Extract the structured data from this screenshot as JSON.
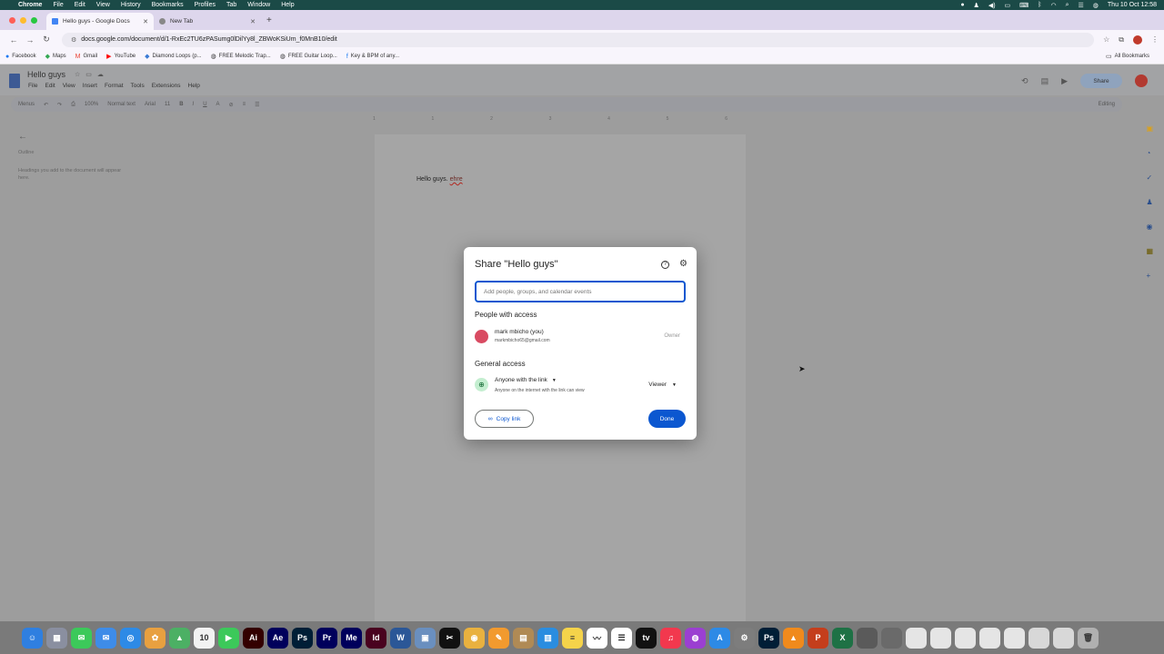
{
  "menubar": {
    "items": [
      "Chrome",
      "File",
      "Edit",
      "View",
      "History",
      "Bookmarks",
      "Profiles",
      "Tab",
      "Window",
      "Help"
    ],
    "datetime": "Thu 10 Oct  12:58"
  },
  "browser": {
    "tabs": [
      {
        "label": "Hello guys - Google Docs",
        "active": true
      },
      {
        "label": "New Tab",
        "active": false
      }
    ],
    "url": "docs.google.com/document/d/1-RxEc2TU6zPASumg0lDilYy8l_ZBWoKSiUm_f0MnB10/edit",
    "bookmarks": [
      "Facebook",
      "Maps",
      "Gmail",
      "YouTube",
      "Diamond Loops (p...",
      "FREE Melodic Trap...",
      "FREE Guitar Loop...",
      "Key & BPM of any..."
    ],
    "all_bookmarks": "All Bookmarks"
  },
  "doc": {
    "title": "Hello guys",
    "menus": [
      "File",
      "Edit",
      "View",
      "Insert",
      "Format",
      "Tools",
      "Extensions",
      "Help"
    ],
    "share_label": "Share",
    "toolbar": {
      "menus": "Menus",
      "zoom": "100%",
      "style": "Normal text",
      "font": "Arial",
      "size": "11",
      "mode": "Editing"
    },
    "ruler": [
      "1",
      "1",
      "2",
      "3",
      "4",
      "5",
      "6"
    ],
    "outline_title": "Outline",
    "outline_note": "Headings you add to the document will appear here.",
    "body_text": "Hello guys. ",
    "body_misspelled": "ehre"
  },
  "dialog": {
    "title": "Share \"Hello guys\"",
    "input_placeholder": "Add people, groups, and calendar events",
    "people_heading": "People with access",
    "person": {
      "name": "mark mbicho (you)",
      "email": "markmbicho65@gmail.com",
      "role": "Owner"
    },
    "general_heading": "General access",
    "access": {
      "scope": "Anyone with the link",
      "description": "Anyone on the internet with the link can view",
      "role": "Viewer"
    },
    "copy_link": "Copy link",
    "done": "Done"
  },
  "dock": {
    "apps": [
      {
        "name": "Finder",
        "glyph": "☺",
        "color": "#2f7fe0"
      },
      {
        "name": "Launchpad",
        "glyph": "▦",
        "color": "#8a8fa0"
      },
      {
        "name": "Messages",
        "glyph": "✉",
        "color": "#3cc95a"
      },
      {
        "name": "Mail",
        "glyph": "✉",
        "color": "#3e8ce8"
      },
      {
        "name": "Safari",
        "glyph": "◎",
        "color": "#2d8ae6"
      },
      {
        "name": "Photos",
        "glyph": "✿",
        "color": "#e8a040"
      },
      {
        "name": "Maps",
        "glyph": "▲",
        "color": "#4cb064"
      },
      {
        "name": "Calendar",
        "glyph": "10",
        "color": "#f2f2f2"
      },
      {
        "name": "FaceTime",
        "glyph": "▶",
        "color": "#3cc95a"
      },
      {
        "name": "Illustrator",
        "glyph": "Ai",
        "color": "#330000"
      },
      {
        "name": "After Effects",
        "glyph": "Ae",
        "color": "#00005b"
      },
      {
        "name": "Photoshop",
        "glyph": "Ps",
        "color": "#001e36"
      },
      {
        "name": "Premiere",
        "glyph": "Pr",
        "color": "#00005b"
      },
      {
        "name": "Media Encoder",
        "glyph": "Me",
        "color": "#00005b"
      },
      {
        "name": "InDesign",
        "glyph": "Id",
        "color": "#49021f"
      },
      {
        "name": "Word",
        "glyph": "W",
        "color": "#2b5797"
      },
      {
        "name": "Preview",
        "glyph": "▣",
        "color": "#6a8fbf"
      },
      {
        "name": "CapCut",
        "glyph": "✂",
        "color": "#111111"
      },
      {
        "name": "Chrome",
        "glyph": "◉",
        "color": "#e9b13f"
      },
      {
        "name": "Pages",
        "glyph": "✎",
        "color": "#f29a2e"
      },
      {
        "name": "Archive",
        "glyph": "▤",
        "color": "#b08a55"
      },
      {
        "name": "Keynote",
        "glyph": "▥",
        "color": "#2a8de0"
      },
      {
        "name": "Notes",
        "glyph": "≡",
        "color": "#f5d34a"
      },
      {
        "name": "Freeform",
        "glyph": "〰",
        "color": "#ffffff"
      },
      {
        "name": "Reminders",
        "glyph": "☰",
        "color": "#ffffff"
      },
      {
        "name": "Apple TV",
        "glyph": "tv",
        "color": "#111111"
      },
      {
        "name": "Music",
        "glyph": "♫",
        "color": "#f2384e"
      },
      {
        "name": "Podcasts",
        "glyph": "◍",
        "color": "#9b3fd1"
      },
      {
        "name": "App Store",
        "glyph": "A",
        "color": "#2d8ae6"
      },
      {
        "name": "System Settings",
        "glyph": "⚙",
        "color": "#7d7d7d"
      },
      {
        "name": "Photoshop",
        "glyph": "Ps",
        "color": "#001e36"
      },
      {
        "name": "VLC",
        "glyph": "▲",
        "color": "#f08a1c"
      },
      {
        "name": "PowerPoint",
        "glyph": "P",
        "color": "#c43e1c"
      },
      {
        "name": "Excel",
        "glyph": "X",
        "color": "#1e7145"
      },
      {
        "name": "Window 1",
        "glyph": "",
        "color": "#5a5a5a"
      },
      {
        "name": "Window 2",
        "glyph": "",
        "color": "#6a6a6a"
      },
      {
        "name": "Window 3",
        "glyph": "",
        "color": "#e5e5e5"
      },
      {
        "name": "Window 4",
        "glyph": "",
        "color": "#e5e5e5"
      },
      {
        "name": "Window 5",
        "glyph": "",
        "color": "#e5e5e5"
      },
      {
        "name": "Window 6",
        "glyph": "",
        "color": "#e5e5e5"
      },
      {
        "name": "Window 7",
        "glyph": "",
        "color": "#e5e5e5"
      },
      {
        "name": "Window 8",
        "glyph": "",
        "color": "#d8d8d8"
      },
      {
        "name": "Window 9",
        "glyph": "",
        "color": "#d8d8d8"
      },
      {
        "name": "Trash",
        "glyph": "🗑",
        "color": "#b0b0b0"
      }
    ]
  },
  "colors": {
    "accent": "#0b57d0",
    "menubar": "#1b4a47",
    "tabbar": "#ddd6ec"
  }
}
